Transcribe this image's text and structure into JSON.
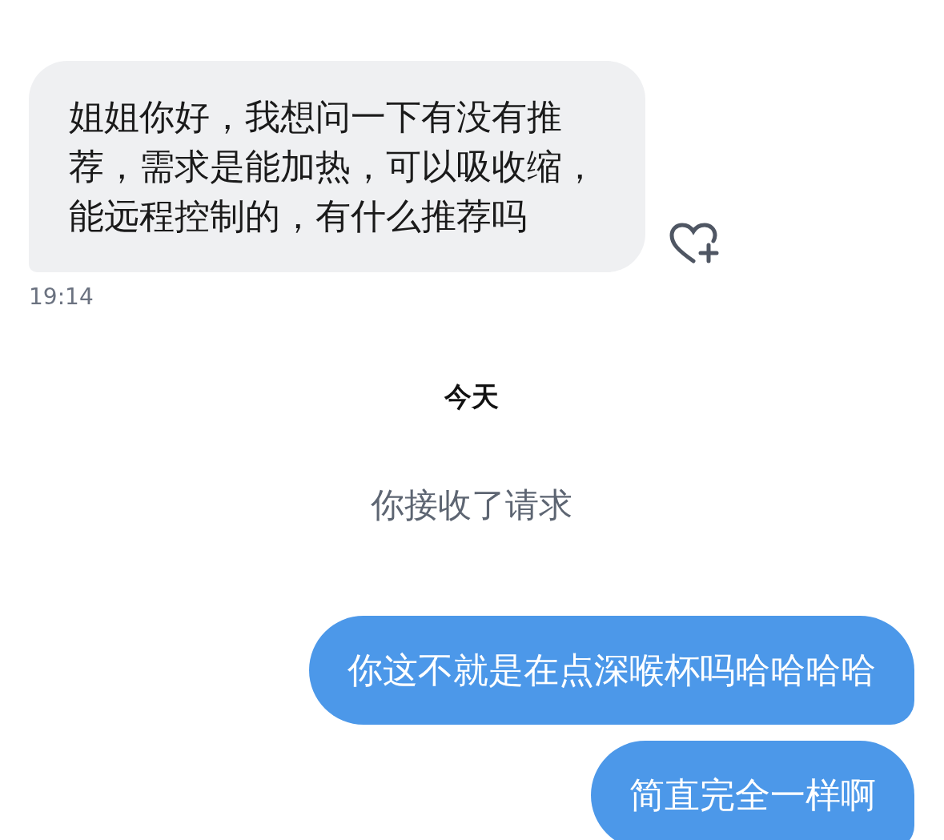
{
  "messages": [
    {
      "kind": "incoming",
      "text": "姐姐你好，我想问一下有没有推荐，需求是能加热，可以吸收缩，能远程控制的，有什么推荐吗",
      "time": "19:14"
    },
    {
      "kind": "date",
      "text": "今天"
    },
    {
      "kind": "system",
      "text": "你接收了请求"
    },
    {
      "kind": "outgoing",
      "text": "你这不就是在点深喉杯吗哈哈哈哈"
    },
    {
      "kind": "outgoing",
      "text": "简直完全一样啊"
    }
  ]
}
